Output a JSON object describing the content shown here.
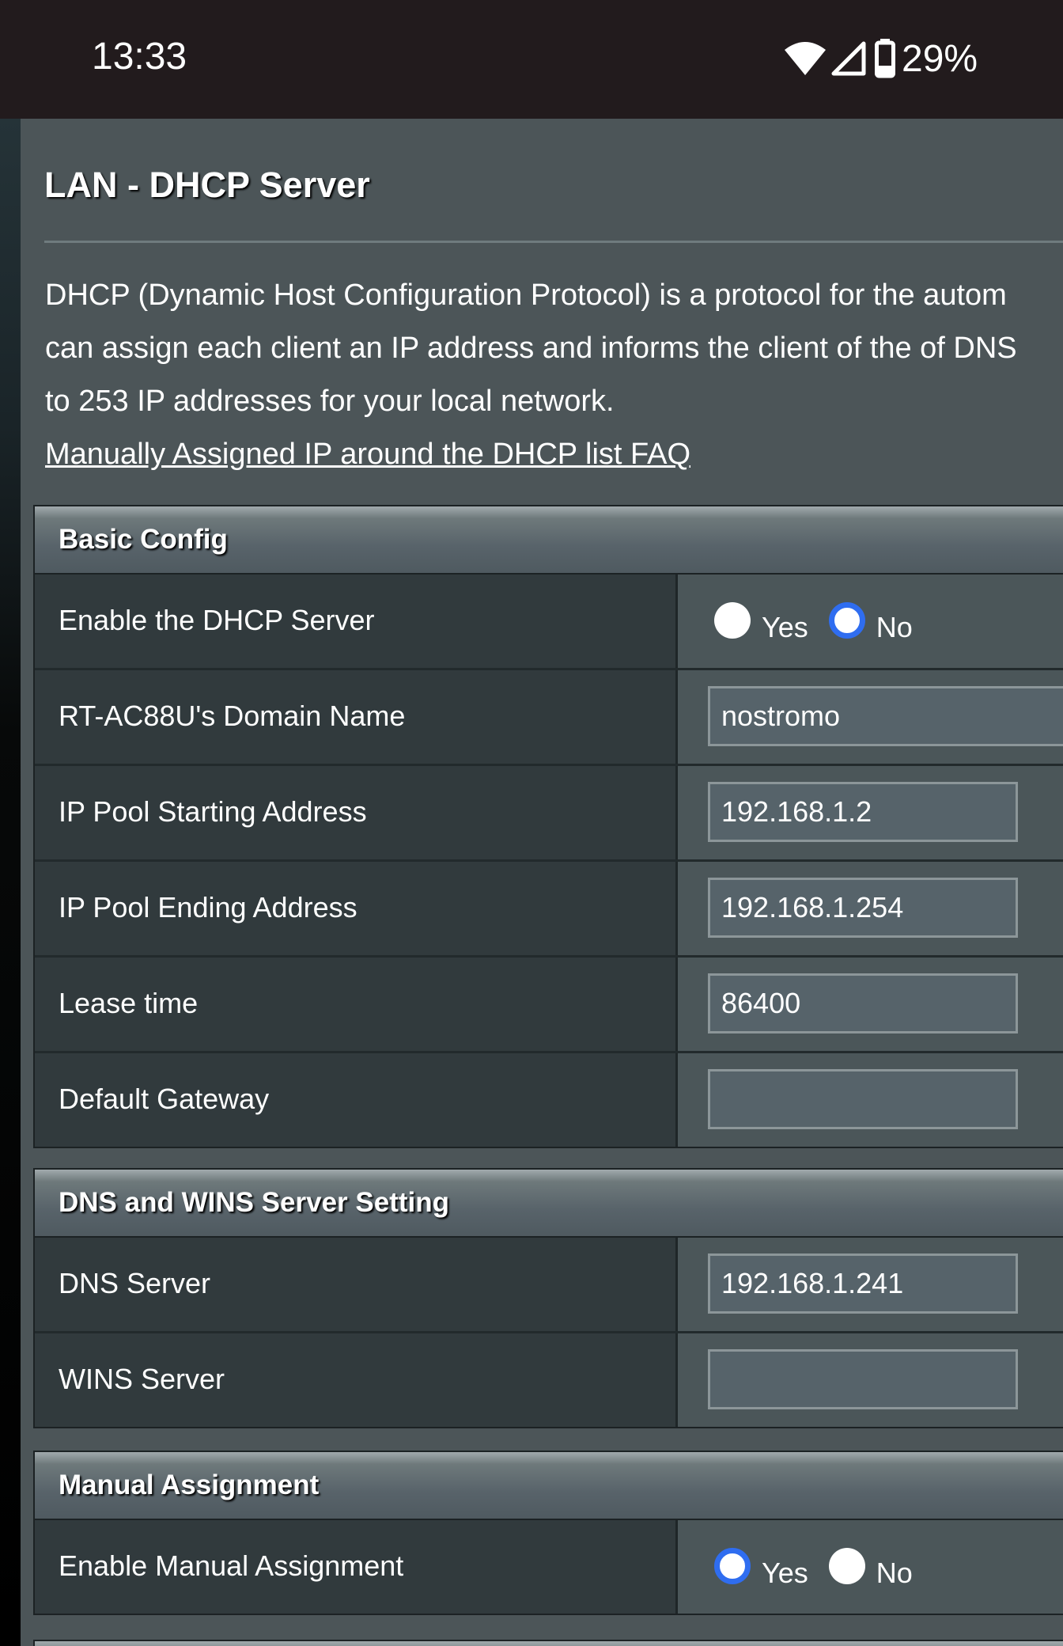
{
  "status_bar": {
    "time": "13:33",
    "battery": "29%",
    "icons": [
      "wifi-icon",
      "cell-signal-icon",
      "battery-icon"
    ]
  },
  "page": {
    "title": "LAN - DHCP Server",
    "description_lines": [
      "DHCP (Dynamic Host Configuration Protocol) is a protocol for the autom",
      "can assign each client an IP address and informs the client of the of DNS",
      "to 253 IP addresses for your local network."
    ],
    "faq_link": "Manually Assigned IP around the DHCP list FAQ"
  },
  "basic_config": {
    "header": "Basic Config",
    "enable_dhcp": {
      "label": "Enable the DHCP Server",
      "yes": "Yes",
      "no": "No",
      "selected": "No"
    },
    "domain_name": {
      "label": "RT-AC88U's Domain Name",
      "value": "nostromo"
    },
    "pool_start": {
      "label": "IP Pool Starting Address",
      "value": "192.168.1.2"
    },
    "pool_end": {
      "label": "IP Pool Ending Address",
      "value": "192.168.1.254"
    },
    "lease_time": {
      "label": "Lease time",
      "value": "86400"
    },
    "default_gateway": {
      "label": "Default Gateway",
      "value": ""
    }
  },
  "dns_wins": {
    "header": "DNS and WINS Server Setting",
    "dns_server": {
      "label": "DNS Server",
      "value": "192.168.1.241"
    },
    "wins_server": {
      "label": "WINS Server",
      "value": ""
    }
  },
  "manual_assignment": {
    "header": "Manual Assignment",
    "enable_manual": {
      "label": "Enable Manual Assignment",
      "yes": "Yes",
      "no": "No",
      "selected": "Yes"
    }
  },
  "colors": {
    "radio_selected": "#2f6df0",
    "page_bg": "#4c5558",
    "label_bg": "#313a3d"
  }
}
